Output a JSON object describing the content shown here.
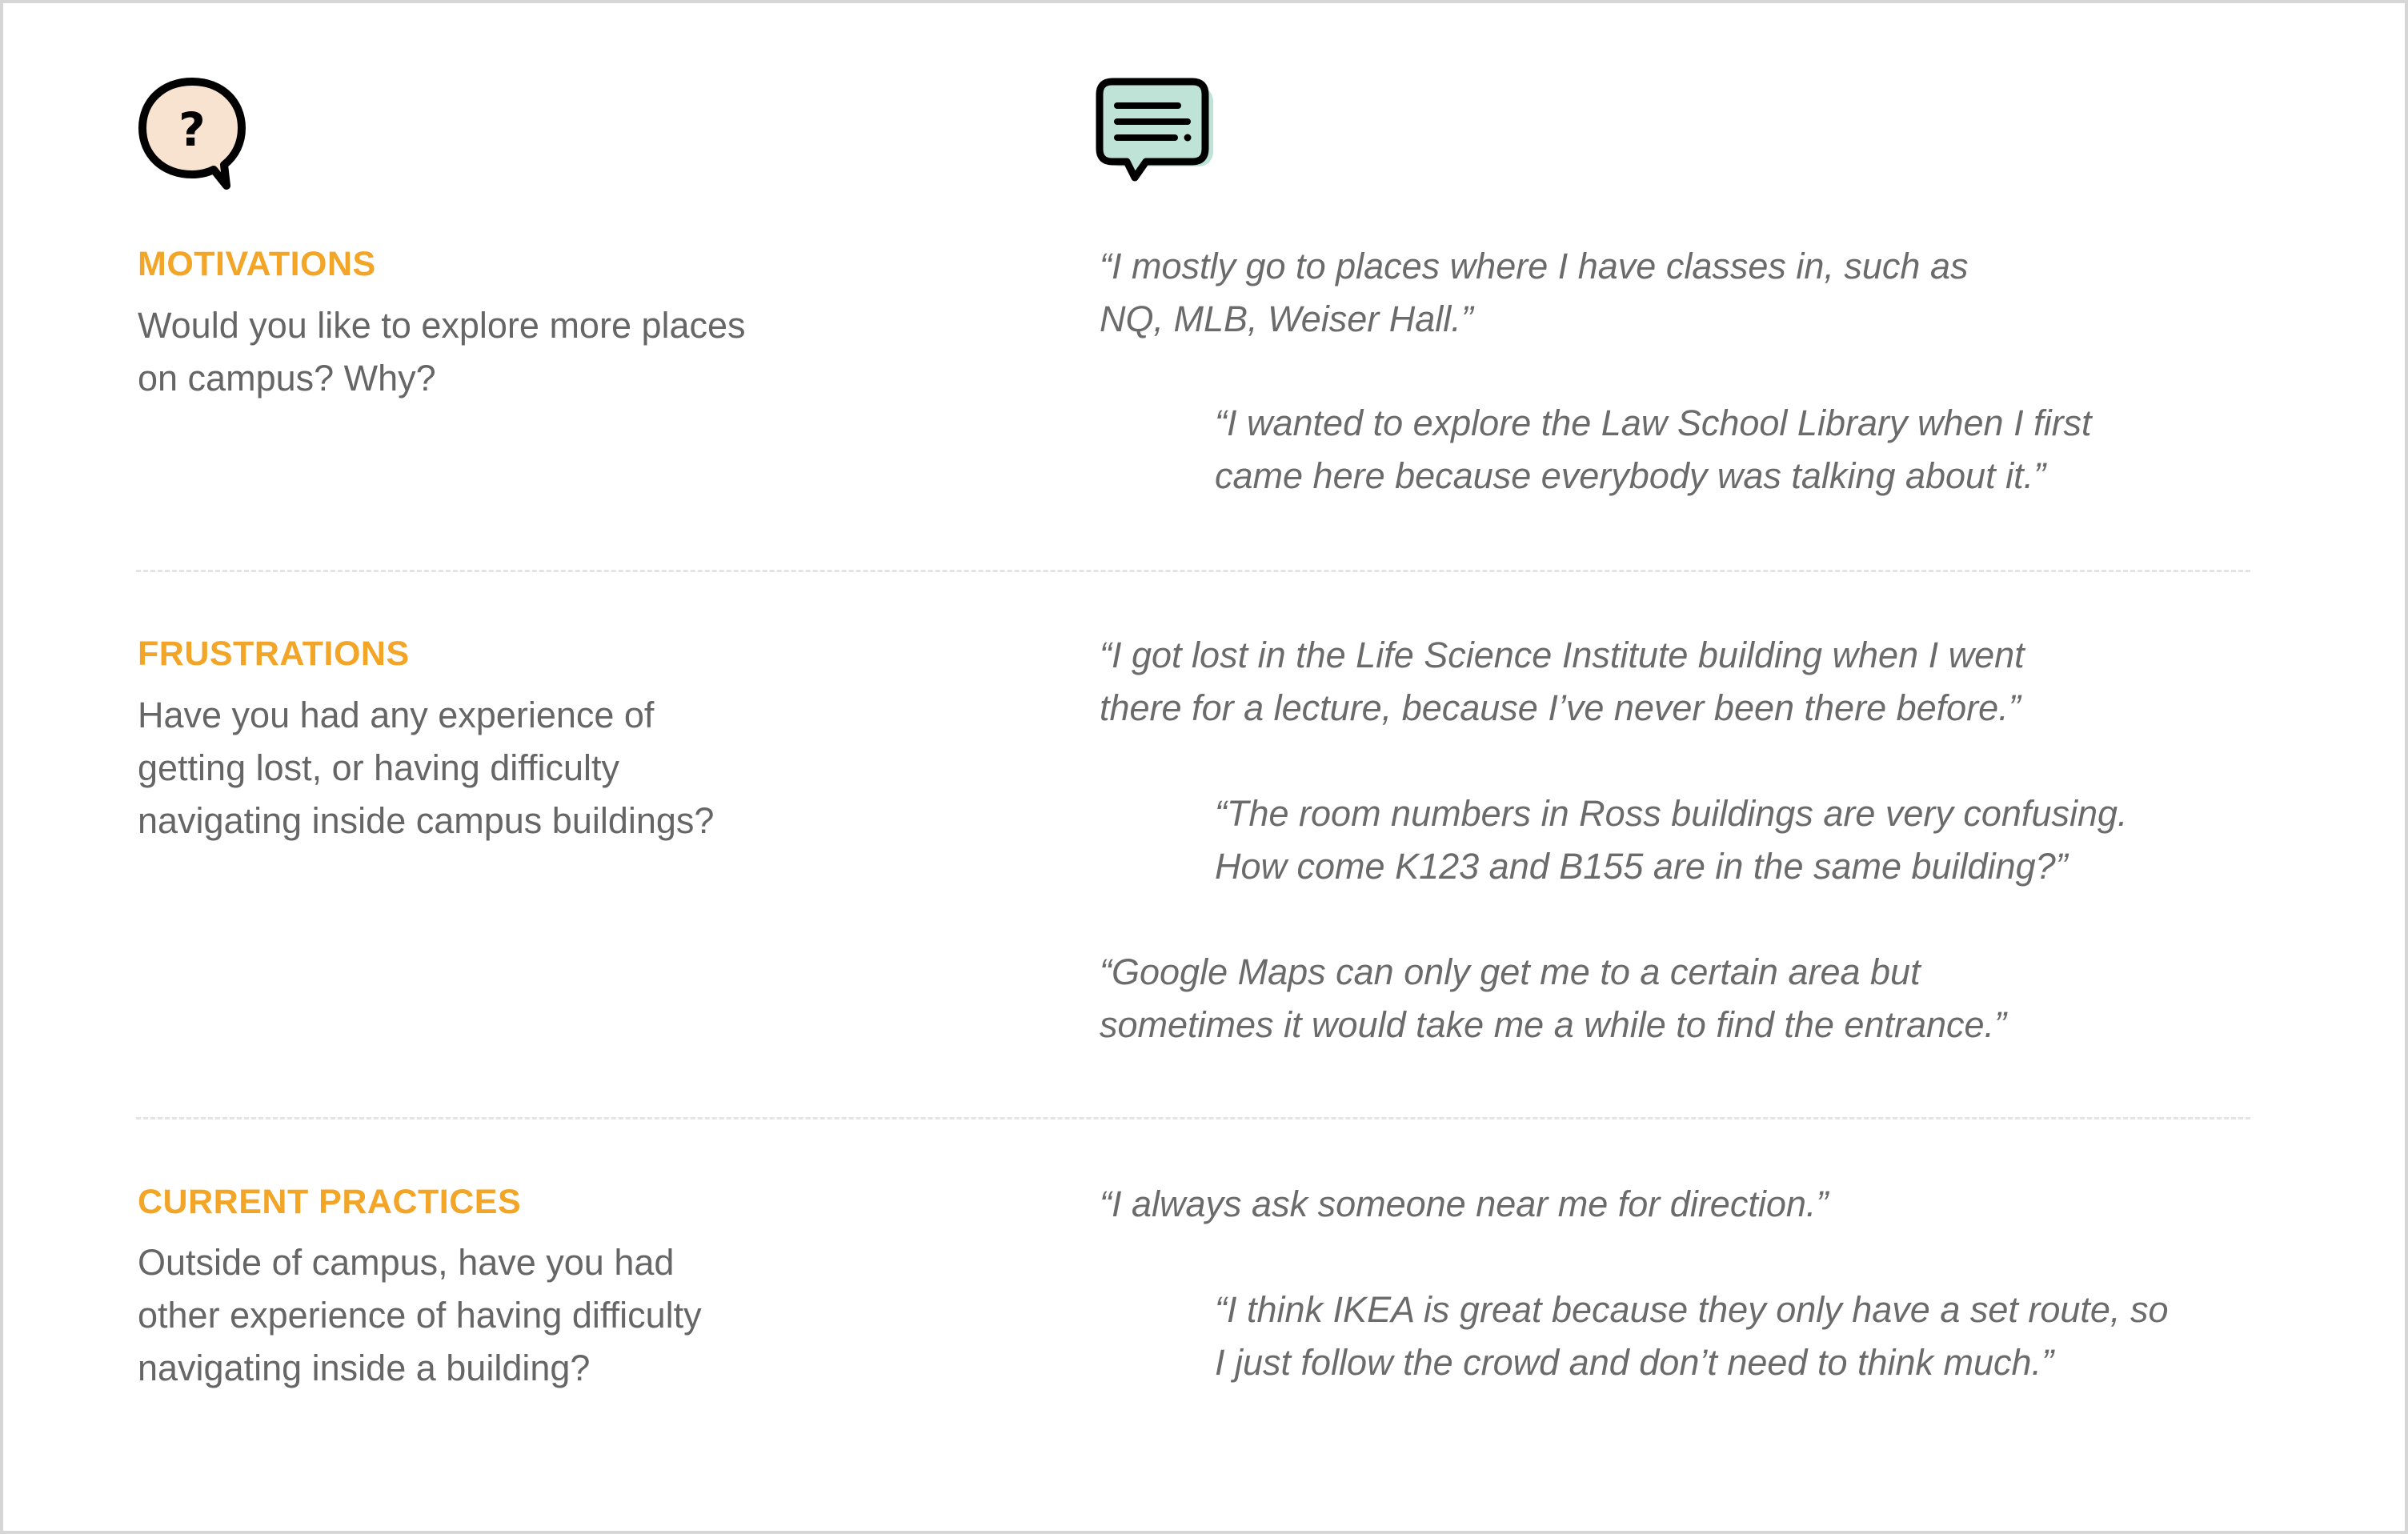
{
  "icons": {
    "question": {
      "name": "question-bubble-icon",
      "glyph": "?",
      "fill": "#f8e3d0",
      "stroke": "#000000"
    },
    "message": {
      "name": "message-bubble-icon",
      "fill": "#bfe3d6",
      "stroke": "#000000"
    }
  },
  "colors": {
    "accent": "#f2a526",
    "question_text": "#666666",
    "quote_text": "#6b6b6b",
    "divider": "#e4e4e4",
    "border": "#d6d6d6"
  },
  "sections": [
    {
      "title": "MOTIVATIONS",
      "question": "Would you like to explore more places on campus? Why?",
      "quotes": [
        "“I mostly go to places where I have classes in, such as\nNQ, MLB, Weiser Hall.”",
        "“I wanted to explore the Law School Library when I first\ncame here because everybody was talking about it.”"
      ]
    },
    {
      "title": "FRUSTRATIONS",
      "question": "Have you had any experience of getting lost, or having difficulty navigating inside campus buildings?",
      "quotes": [
        "“I got lost in the Life Science Institute building when I went\nthere for a lecture, because I’ve never been there before.”",
        "“The room numbers in Ross buildings are very confusing.\nHow come K123 and B155 are in the same building?”",
        "“Google Maps can only get me to a certain area but\nsometimes it would take me a while to find the entrance.”"
      ]
    },
    {
      "title": "CURRENT PRACTICES",
      "question": "Outside of campus, have you had other experience of having difficulty navigating inside a building?",
      "quotes": [
        "“I always ask someone near me for direction.”",
        "“I think IKEA is great because they only have a set route, so\nI just follow the crowd and don’t need to think much.”"
      ]
    }
  ]
}
